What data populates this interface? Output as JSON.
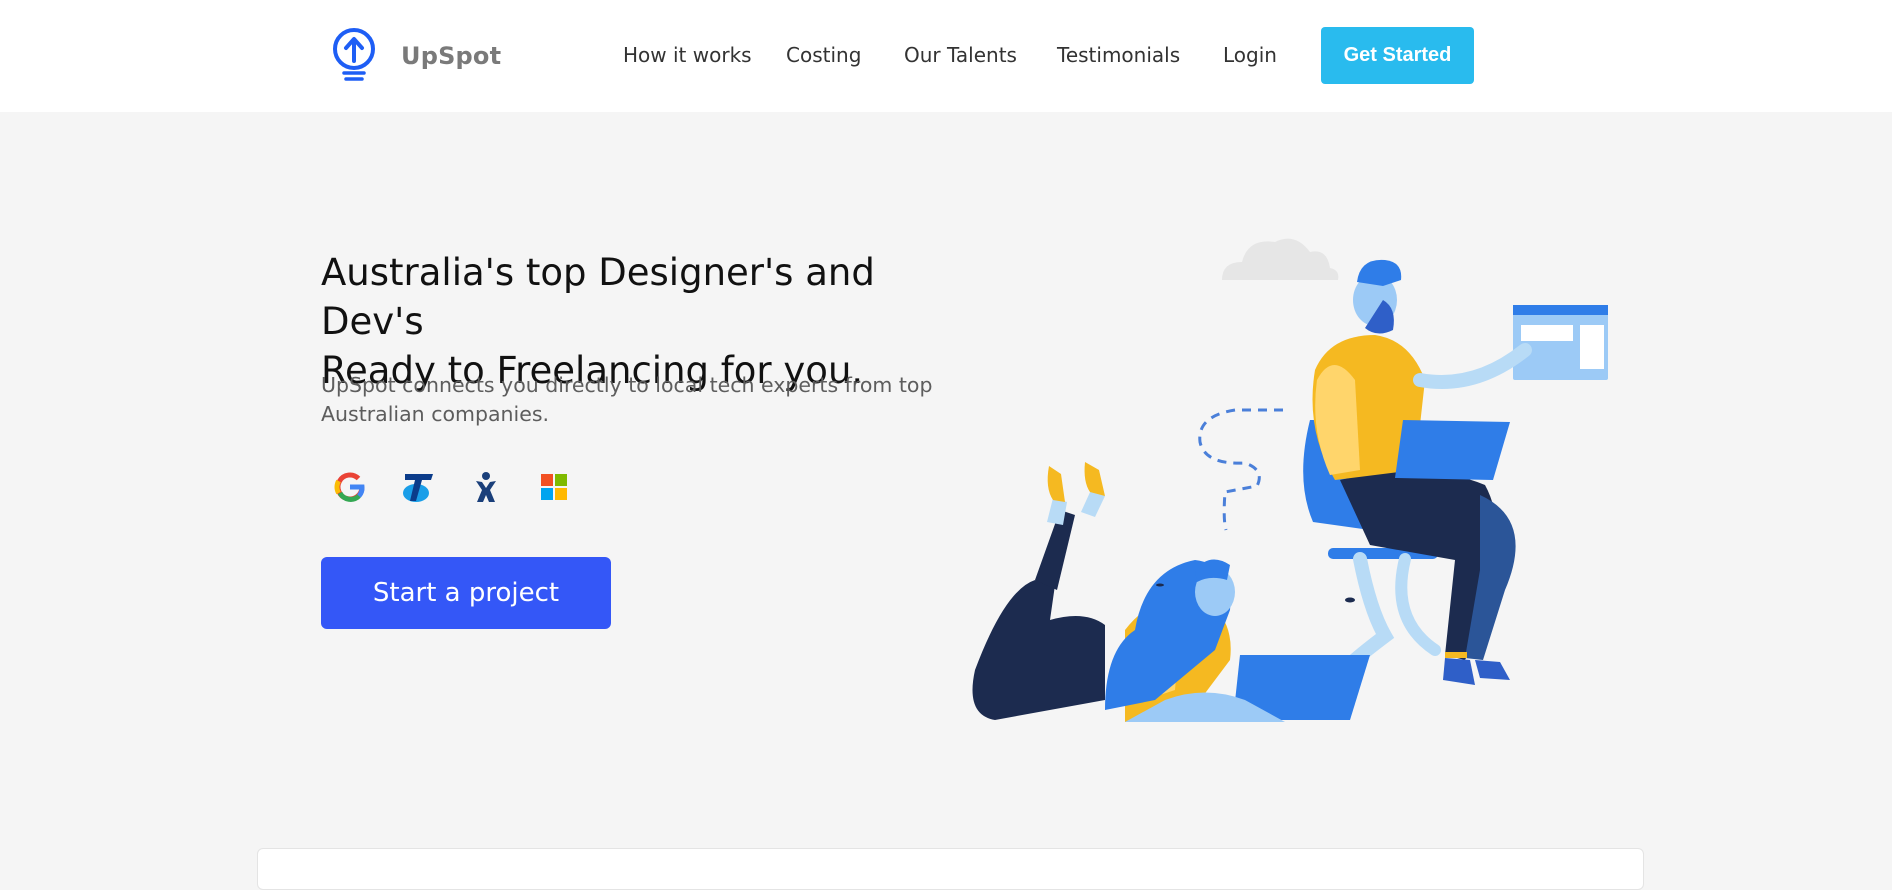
{
  "brand": {
    "name": "UpSpot",
    "icon": "lightbulb-upload-icon",
    "accent": "#1e5ef5"
  },
  "nav": {
    "items": [
      {
        "label": "How it works"
      },
      {
        "label": "Costing"
      },
      {
        "label": "Our Talents"
      },
      {
        "label": "Testimonials"
      },
      {
        "label": "Login"
      }
    ],
    "cta_label": "Get Started",
    "cta_color": "#29bbee"
  },
  "hero": {
    "title_line1": "Australia's top Designer's and Dev's",
    "title_line2": "Ready to Freelancing for you.",
    "subtitle": "UpSpot connects you directly to local tech experts from top Australian companies.",
    "partners": [
      {
        "icon": "google-logo-icon"
      },
      {
        "icon": "telstra-logo-icon"
      },
      {
        "icon": "atlassian-jira-logo-icon"
      },
      {
        "icon": "microsoft-logo-icon"
      }
    ],
    "cta_label": "Start a project",
    "cta_color": "#3457f7"
  },
  "illustration": {
    "icon": "freelancers-working-illustration"
  }
}
